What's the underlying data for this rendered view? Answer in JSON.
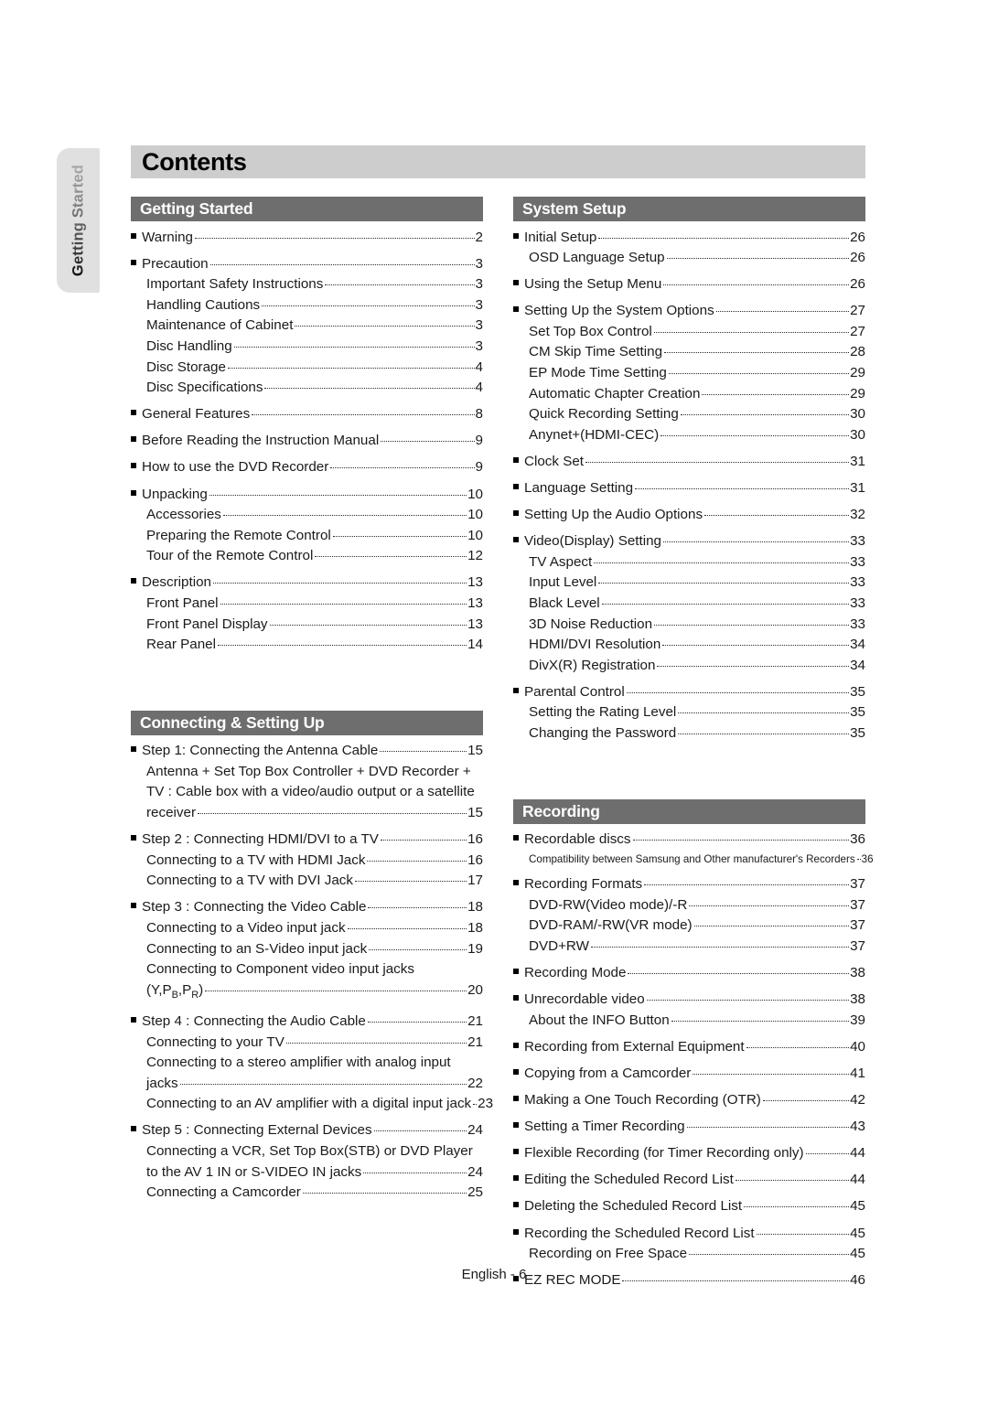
{
  "side_tab": {
    "label": "Getting Started"
  },
  "page": {
    "title": "Contents",
    "footer": "English - 6"
  },
  "sections": {
    "getting_started": {
      "heading": "Getting Started",
      "entries": [
        {
          "level": 1,
          "title": "Warning",
          "page": "2"
        },
        {
          "level": 1,
          "title": "Precaution",
          "page": "3"
        },
        {
          "level": 2,
          "title": "Important Safety Instructions",
          "page": "3"
        },
        {
          "level": 2,
          "title": "Handling Cautions",
          "page": "3"
        },
        {
          "level": 2,
          "title": "Maintenance of Cabinet",
          "page": "3"
        },
        {
          "level": 2,
          "title": "Disc Handling",
          "page": "3"
        },
        {
          "level": 2,
          "title": "Disc Storage",
          "page": "4"
        },
        {
          "level": 2,
          "title": "Disc Specifications",
          "page": "4"
        },
        {
          "level": 1,
          "title": "General Features",
          "page": "8"
        },
        {
          "level": 1,
          "title": "Before Reading the Instruction Manual",
          "page": "9"
        },
        {
          "level": 1,
          "title": "How to use the DVD Recorder",
          "page": "9"
        },
        {
          "level": 1,
          "title": "Unpacking",
          "page": "10"
        },
        {
          "level": 2,
          "title": "Accessories",
          "page": "10"
        },
        {
          "level": 2,
          "title": "Preparing the Remote Control",
          "page": "10"
        },
        {
          "level": 2,
          "title": "Tour of the Remote Control",
          "page": "12"
        },
        {
          "level": 1,
          "title": "Description",
          "page": "13"
        },
        {
          "level": 2,
          "title": "Front Panel",
          "page": "13"
        },
        {
          "level": 2,
          "title": "Front Panel Display",
          "page": "13"
        },
        {
          "level": 2,
          "title": "Rear Panel",
          "page": "14"
        }
      ]
    },
    "connecting": {
      "heading": "Connecting & Setting Up",
      "entries": [
        {
          "level": 1,
          "title": "Step 1: Connecting the Antenna Cable",
          "page": "15"
        },
        {
          "level": 2,
          "title": "Antenna + Set Top Box Controller + DVD Recorder +",
          "page": "",
          "wrap": true
        },
        {
          "level": 2,
          "title": "TV : Cable box with a video/audio output or a satellite",
          "page": "",
          "wrap": true
        },
        {
          "level": 2,
          "title": "receiver",
          "page": "15"
        },
        {
          "level": 1,
          "title": "Step 2 : Connecting HDMI/DVI to a TV",
          "page": "16"
        },
        {
          "level": 2,
          "title": "Connecting to a TV with HDMI Jack",
          "page": "16"
        },
        {
          "level": 2,
          "title": "Connecting to a TV with DVI Jack",
          "page": "17"
        },
        {
          "level": 1,
          "title": "Step 3 : Connecting the Video Cable",
          "page": "18"
        },
        {
          "level": 2,
          "title": "Connecting to a Video input jack",
          "page": "18"
        },
        {
          "level": 2,
          "title": "Connecting to an S-Video input jack",
          "page": "19"
        },
        {
          "level": 2,
          "title": "Connecting to Component video input jacks",
          "page": "",
          "wrap": true
        },
        {
          "level": 2,
          "title": "(Y,PB,PR)",
          "page": "20",
          "subscript": true
        },
        {
          "level": 1,
          "title": "Step 4 : Connecting the Audio Cable",
          "page": "21"
        },
        {
          "level": 2,
          "title": "Connecting to your TV",
          "page": "21"
        },
        {
          "level": 2,
          "title": "Connecting to a stereo amplifier with analog input",
          "page": "",
          "wrap": true
        },
        {
          "level": 2,
          "title": "jacks",
          "page": "22"
        },
        {
          "level": 2,
          "title": "Connecting to an AV amplifier with a digital input jack",
          "page": "23"
        },
        {
          "level": 1,
          "title": "Step 5 : Connecting External Devices",
          "page": "24"
        },
        {
          "level": 2,
          "title": "Connecting a VCR, Set Top Box(STB) or DVD Player",
          "page": "",
          "wrap": true
        },
        {
          "level": 2,
          "title": "to the AV 1 IN or S-VIDEO IN jacks",
          "page": "24"
        },
        {
          "level": 2,
          "title": "Connecting a Camcorder",
          "page": "25"
        }
      ]
    },
    "system_setup": {
      "heading": "System Setup",
      "entries": [
        {
          "level": 1,
          "title": "Initial Setup",
          "page": "26"
        },
        {
          "level": 2,
          "title": "OSD Language Setup",
          "page": "26"
        },
        {
          "level": 1,
          "title": "Using the Setup Menu",
          "page": "26"
        },
        {
          "level": 1,
          "title": "Setting Up the System Options",
          "page": "27"
        },
        {
          "level": 2,
          "title": "Set Top Box Control",
          "page": "27"
        },
        {
          "level": 2,
          "title": "CM Skip Time Setting",
          "page": "28"
        },
        {
          "level": 2,
          "title": "EP Mode Time Setting",
          "page": "29"
        },
        {
          "level": 2,
          "title": "Automatic Chapter Creation",
          "page": "29"
        },
        {
          "level": 2,
          "title": "Quick Recording Setting",
          "page": "30"
        },
        {
          "level": 2,
          "title": "Anynet+(HDMI-CEC)",
          "page": "30"
        },
        {
          "level": 1,
          "title": "Clock Set",
          "page": "31"
        },
        {
          "level": 1,
          "title": "Language Setting",
          "page": "31"
        },
        {
          "level": 1,
          "title": "Setting Up the Audio Options",
          "page": "32"
        },
        {
          "level": 1,
          "title": "Video(Display) Setting",
          "page": "33"
        },
        {
          "level": 2,
          "title": "TV Aspect",
          "page": "33"
        },
        {
          "level": 2,
          "title": "Input Level",
          "page": "33"
        },
        {
          "level": 2,
          "title": "Black Level",
          "page": "33"
        },
        {
          "level": 2,
          "title": "3D Noise Reduction",
          "page": "33"
        },
        {
          "level": 2,
          "title": "HDMI/DVI Resolution",
          "page": "34"
        },
        {
          "level": 2,
          "title": "DivX(R) Registration",
          "page": "34"
        },
        {
          "level": 1,
          "title": "Parental Control",
          "page": "35"
        },
        {
          "level": 2,
          "title": "Setting the Rating Level",
          "page": "35"
        },
        {
          "level": 2,
          "title": "Changing the Password",
          "page": "35"
        }
      ]
    },
    "recording": {
      "heading": "Recording",
      "entries": [
        {
          "level": 1,
          "title": "Recordable discs",
          "page": "36"
        },
        {
          "level": 2,
          "title": "Compatibility between Samsung and Other manufacturer's Recorders",
          "page": "36",
          "small": true
        },
        {
          "level": 1,
          "title": "Recording Formats",
          "page": "37"
        },
        {
          "level": 2,
          "title": "DVD-RW(Video mode)/-R",
          "page": "37"
        },
        {
          "level": 2,
          "title": "DVD-RAM/-RW(VR mode)",
          "page": "37"
        },
        {
          "level": 2,
          "title": "DVD+RW",
          "page": "37"
        },
        {
          "level": 1,
          "title": "Recording Mode",
          "page": "38"
        },
        {
          "level": 1,
          "title": "Unrecordable video",
          "page": "38"
        },
        {
          "level": 2,
          "title": "About the INFO Button",
          "page": "39"
        },
        {
          "level": 1,
          "title": "Recording from External Equipment",
          "page": "40"
        },
        {
          "level": 1,
          "title": "Copying from a Camcorder",
          "page": "41"
        },
        {
          "level": 1,
          "title": "Making a One Touch Recording (OTR)",
          "page": "42"
        },
        {
          "level": 1,
          "title": "Setting a Timer Recording",
          "page": "43"
        },
        {
          "level": 1,
          "title": "Flexible Recording (for Timer Recording only)",
          "page": "44"
        },
        {
          "level": 1,
          "title": "Editing the Scheduled Record List",
          "page": "44"
        },
        {
          "level": 1,
          "title": "Deleting the Scheduled Record List",
          "page": "45"
        },
        {
          "level": 1,
          "title": "Recording the Scheduled Record List",
          "page": "45"
        },
        {
          "level": 2,
          "title": "Recording on Free Space",
          "page": "45"
        },
        {
          "level": 1,
          "title": "EZ REC MODE",
          "page": "46"
        }
      ]
    }
  },
  "colors": {
    "title_bar": "#cdcdcd",
    "section_bar": "#6e6e6e",
    "tab_bg": "#e0e0e0"
  }
}
